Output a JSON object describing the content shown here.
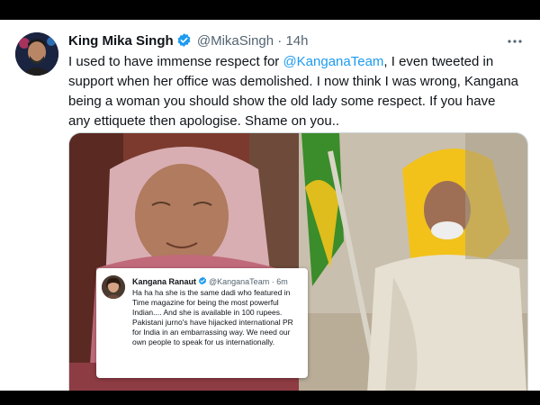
{
  "tweet": {
    "author_name": "King Mika Singh",
    "handle": "@MikaSingh",
    "separator": "·",
    "time": "14h",
    "text_part1": "I used to have immense respect for ",
    "mention": "@KanganaTeam",
    "text_part2": ", I even tweeted in support when her office was demolished. I now think I was wrong, Kangana being a woman you should show the old lady some respect. If you have any ettiquete then apologise. Shame on you.."
  },
  "embedded_tweet": {
    "author_name": "Kangana Ranaut",
    "handle": "@KanganaTeam",
    "separator": "·",
    "time": "6m",
    "text": "Ha ha ha she is the same dadi who featured in Time magazine for being the most powerful Indian.... And she is available in 100 rupees. Pakistani jurno's have hijacked international PR for India in an embarrassing way. We need our own people to speak for us internationally."
  },
  "icons": {
    "verified": "verified-badge-icon",
    "more": "more-options-icon"
  },
  "colors": {
    "verified": "#1d9bf0",
    "mention": "#1d9bf0",
    "text": "#0f1419",
    "muted": "#536471",
    "yellow_dupatta": "#f2c21b",
    "green_flag": "#3b8c2a"
  }
}
